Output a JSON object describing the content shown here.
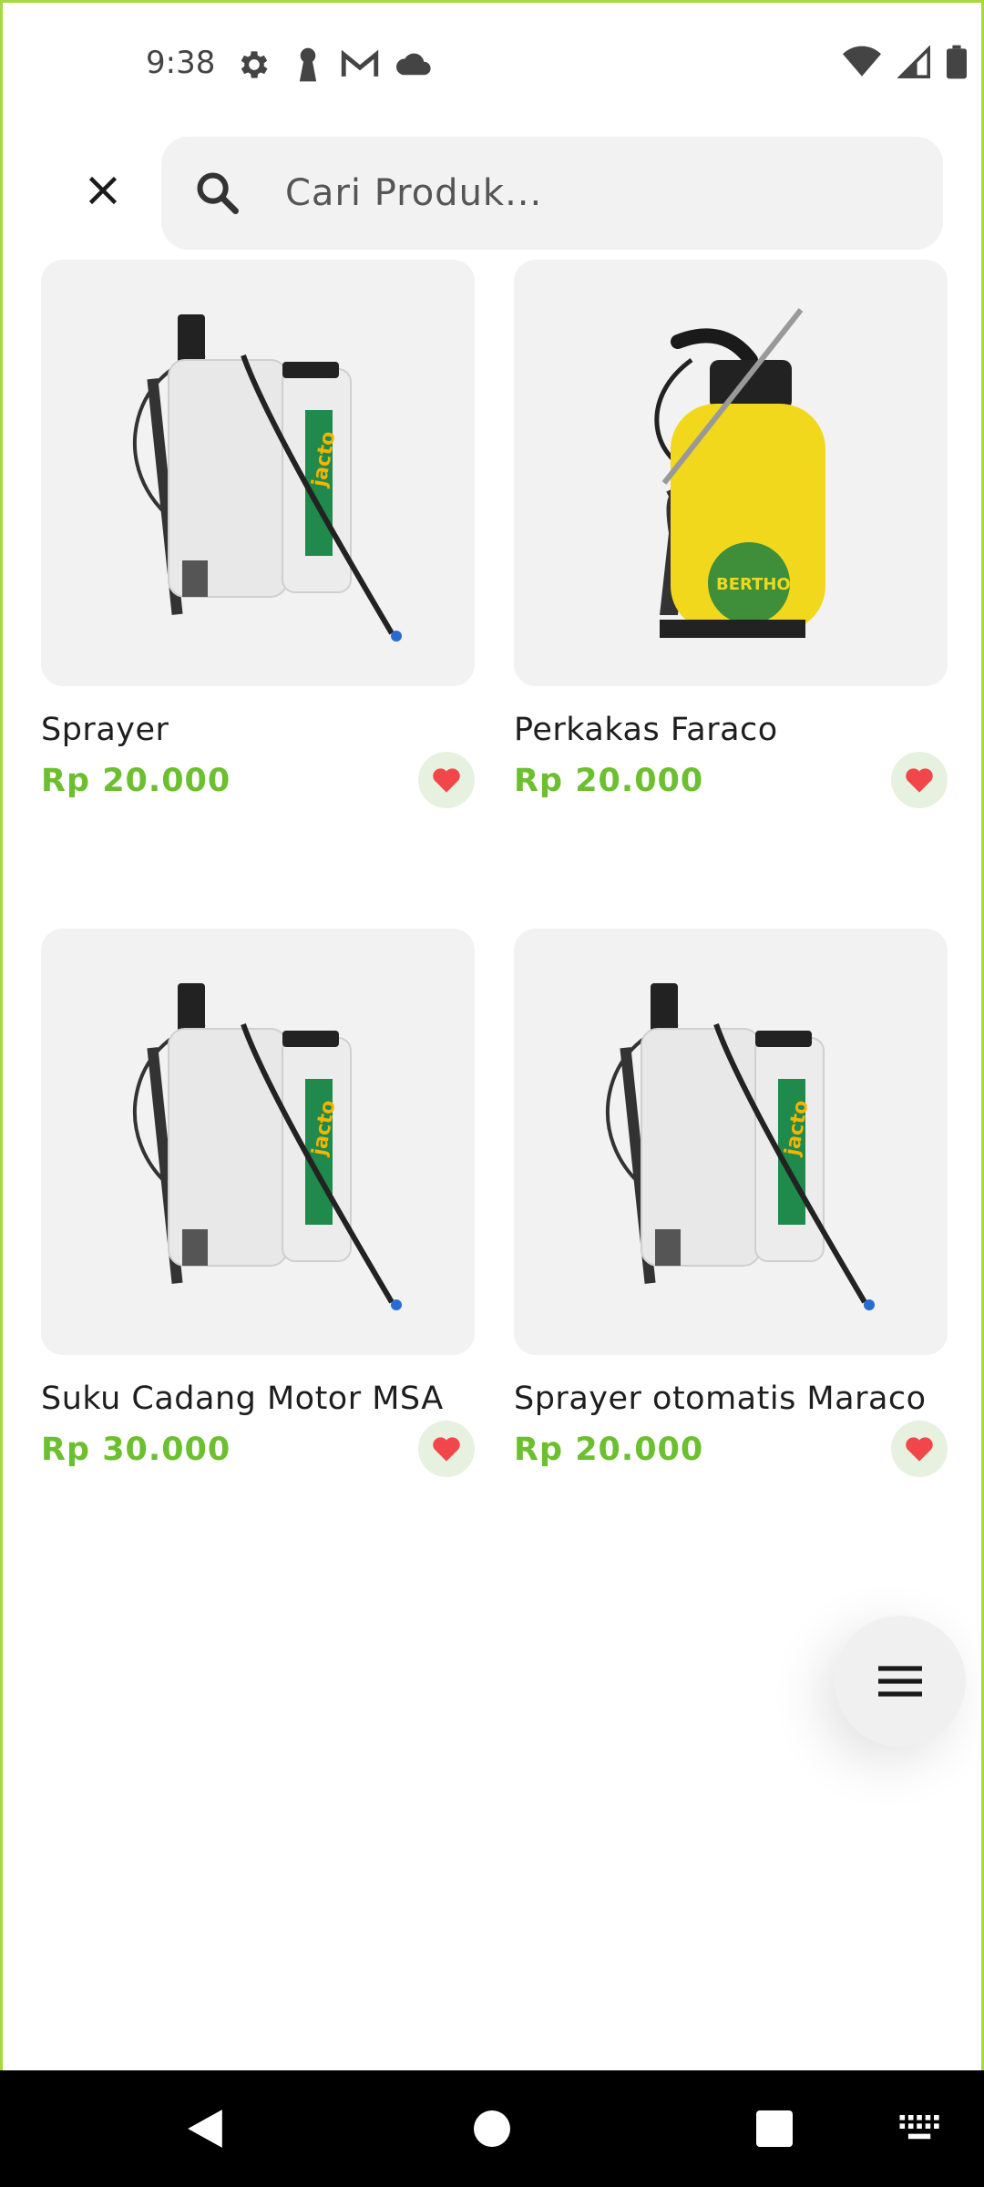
{
  "status_bar": {
    "time": "9:38",
    "left_icons": [
      "gear-icon",
      "keyhole-icon",
      "gmail-icon",
      "cloud-icon"
    ],
    "right_icons": [
      "wifi-icon",
      "signal-icon",
      "battery-icon"
    ]
  },
  "search": {
    "placeholder": "Cari Produk...",
    "value": ""
  },
  "products": [
    {
      "name": "Sprayer",
      "price": "Rp 20.000",
      "image": "backpack-sprayer",
      "favorite": true
    },
    {
      "name": "Perkakas Faraco",
      "price": "Rp 20.000",
      "image": "pressure-sprayer-yellow",
      "favorite": true
    },
    {
      "name": "Suku Cadang Motor MSA",
      "price": "Rp 30.000",
      "image": "backpack-sprayer",
      "favorite": true
    },
    {
      "name": "Sprayer otomatis Maraco",
      "price": "Rp 20.000",
      "image": "backpack-sprayer",
      "favorite": true
    }
  ],
  "colors": {
    "accent": "#6cbf2f",
    "favorite": "#f2474a",
    "frame": "#a6d93a"
  },
  "nav": {
    "items": [
      "back-icon",
      "home-icon",
      "recents-icon",
      "keyboard-icon"
    ]
  }
}
